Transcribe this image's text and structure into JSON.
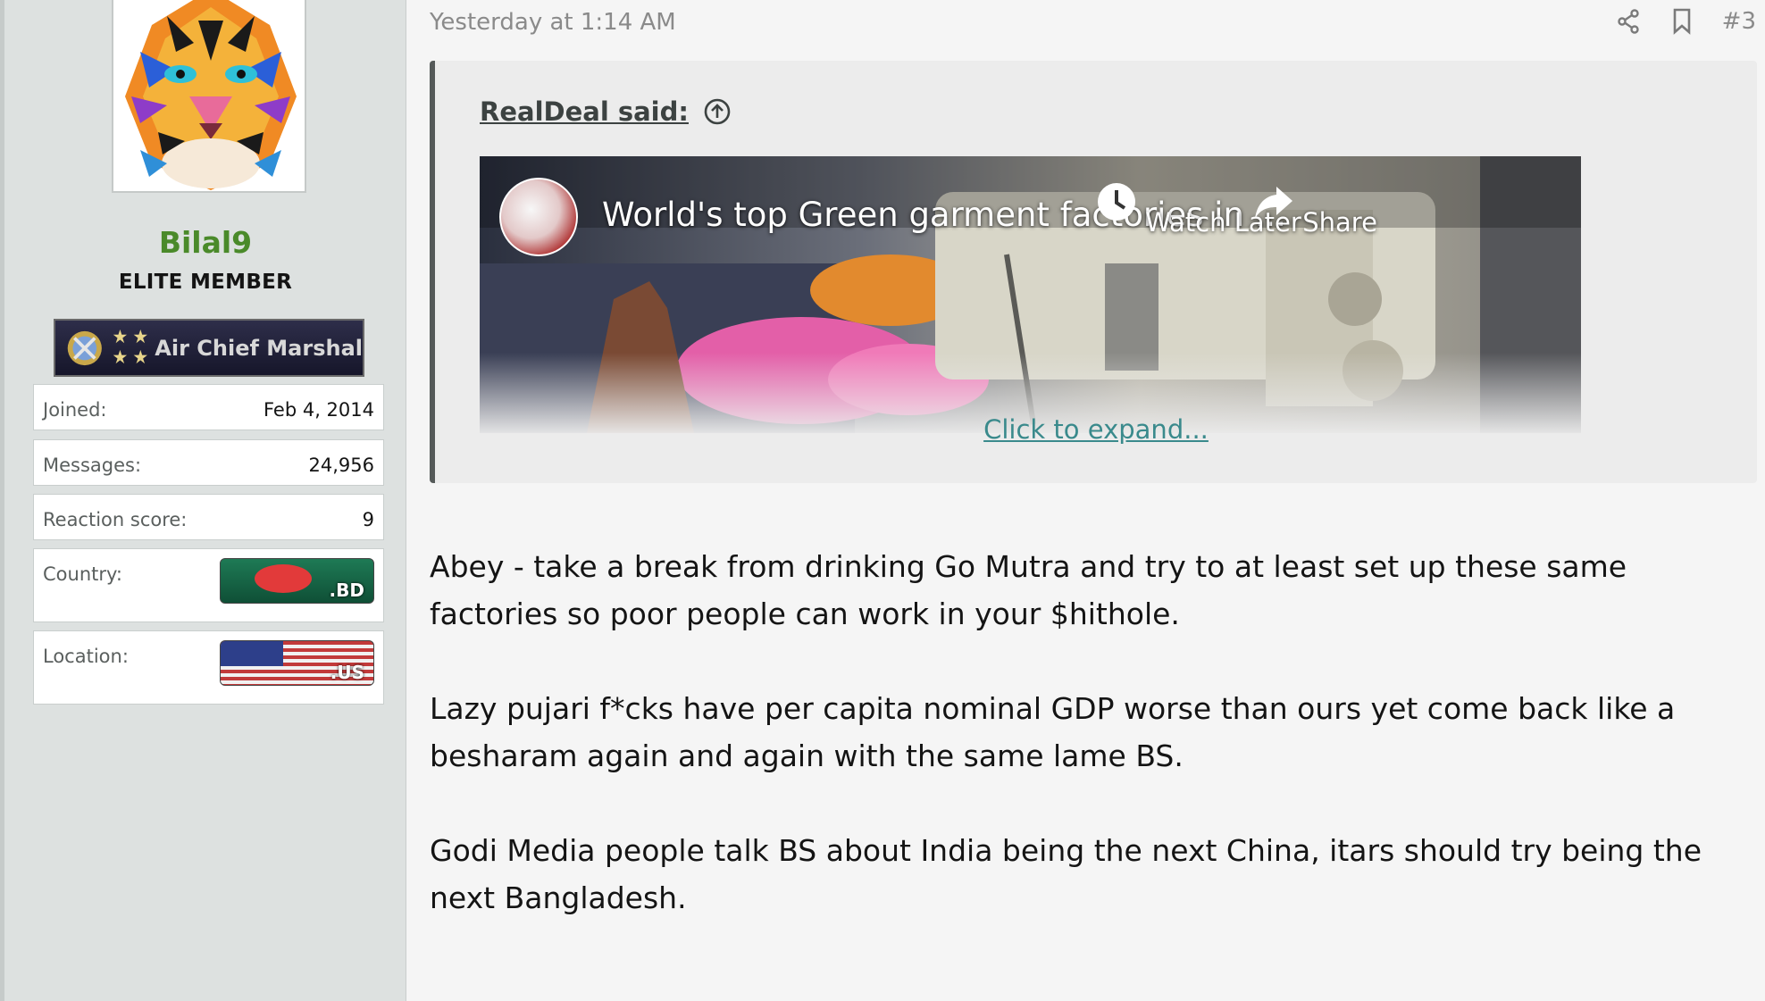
{
  "user": {
    "username": "Bilal9",
    "title": "ELITE MEMBER",
    "rank": "Air Chief Marshal",
    "stats": [
      {
        "label": "Joined:",
        "value": "Feb 4, 2014"
      },
      {
        "label": "Messages:",
        "value": "24,956"
      },
      {
        "label": "Reaction score:",
        "value": "9"
      }
    ],
    "country": {
      "label": "Country:",
      "flag_code": ".BD"
    },
    "location": {
      "label": "Location:",
      "flag_code": ".US"
    }
  },
  "post": {
    "date": "Yesterday at 1:14 AM",
    "number": "#3",
    "actions": [
      "share-icon",
      "bookmark-icon"
    ],
    "quote": {
      "author": "RealDeal said:",
      "video_title": "World's top Green garment factories in ...",
      "watch_later": "Watch Later",
      "share": "Share",
      "expand": "Click to expand..."
    },
    "paragraphs": [
      "Abey - take a break from drinking Go Mutra and try to at least set up these same factories so poor people can work in your $hithole.",
      "Lazy pujari f*cks have per capita nominal GDP worse than ours yet come back like a besharam again and again with the same lame BS.",
      "Godi Media people talk BS about India being the next China, itars should try being the next Bangladesh."
    ]
  },
  "colors": {
    "username": "#4a8a2a",
    "link": "#3a8a8c",
    "quote_bar": "#555a59",
    "sidebar_bg": "#dde1e0"
  }
}
